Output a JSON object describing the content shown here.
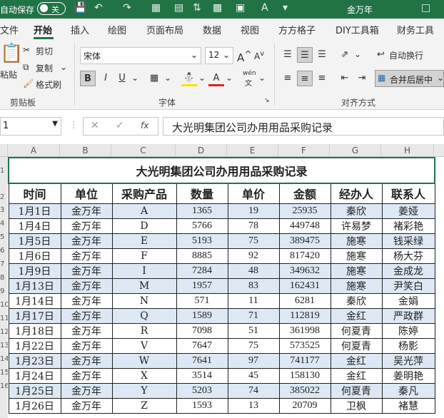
{
  "titlebar": {
    "autosave_label": "自动保存",
    "toggle_label": "关",
    "user_name": "金万年",
    "colors": {
      "bar": "#217346"
    }
  },
  "tabs": [
    "文件",
    "开始",
    "插入",
    "绘图",
    "页面布局",
    "数据",
    "视图",
    "方方格子",
    "DIY工具箱",
    "财务工具"
  ],
  "active_tab": "开始",
  "ribbon": {
    "clipboard": {
      "paste": "粘贴",
      "cut": "剪切",
      "copy": "复制",
      "format_painter": "格式刷",
      "label": "剪贴板"
    },
    "font": {
      "name": "宋体",
      "size": "12",
      "bold": "B",
      "italic": "I",
      "underline": "U",
      "grow": "A",
      "shrink": "A",
      "label": "字体",
      "wen": "wén"
    },
    "alignment": {
      "wrap": "自动换行",
      "merge": "合并后居中",
      "label": "对齐方式"
    }
  },
  "formula_bar": {
    "name_box": "1",
    "fx": "fx",
    "content": "大光明集团公司办用用品采购记录"
  },
  "columns": [
    "A",
    "B",
    "C",
    "D",
    "E",
    "F",
    "G",
    "H"
  ],
  "row_numbers": [
    "1",
    "2",
    "3",
    "4",
    "5",
    "6",
    "7",
    "8",
    "9",
    "10",
    "11",
    "12",
    "13",
    "14",
    "15",
    "16"
  ],
  "table": {
    "title": "大光明集团公司办用用品采购记录",
    "headers": [
      "时间",
      "单位",
      "采购产品",
      "数量",
      "单价",
      "金额",
      "经办人",
      "联系人"
    ],
    "rows": [
      [
        "1月1日",
        "金万年",
        "A",
        "1365",
        "19",
        "25935",
        "秦欣",
        "姜娅"
      ],
      [
        "1月4日",
        "金万年",
        "D",
        "5766",
        "78",
        "449748",
        "许易梦",
        "褚彩艳"
      ],
      [
        "1月5日",
        "金万年",
        "E",
        "5193",
        "75",
        "389475",
        "施寒",
        "钱采绿"
      ],
      [
        "1月6日",
        "金万年",
        "F",
        "8885",
        "92",
        "817420",
        "施寒",
        "杨大芬"
      ],
      [
        "1月9日",
        "金万年",
        "I",
        "7284",
        "48",
        "349632",
        "施寒",
        "金成龙"
      ],
      [
        "1月13日",
        "金万年",
        "M",
        "1957",
        "83",
        "162431",
        "施寒",
        "尹笑白"
      ],
      [
        "1月14日",
        "金万年",
        "N",
        "571",
        "11",
        "6281",
        "秦欣",
        "金娟"
      ],
      [
        "1月17日",
        "金万年",
        "Q",
        "1589",
        "71",
        "112819",
        "金红",
        "严政群"
      ],
      [
        "1月18日",
        "金万年",
        "R",
        "7098",
        "51",
        "361998",
        "何夏青",
        "陈婷"
      ],
      [
        "1月22日",
        "金万年",
        "V",
        "7647",
        "75",
        "573525",
        "何夏青",
        "杨影"
      ],
      [
        "1月23日",
        "金万年",
        "W",
        "7641",
        "97",
        "741177",
        "金红",
        "吴光萍"
      ],
      [
        "1月24日",
        "金万年",
        "X",
        "3514",
        "45",
        "158130",
        "金红",
        "姜明艳"
      ],
      [
        "1月25日",
        "金万年",
        "Y",
        "5203",
        "74",
        "385022",
        "何夏青",
        "秦凡"
      ],
      [
        "1月26日",
        "金万年",
        "Z",
        "1593",
        "13",
        "20709",
        "卫枫",
        "褚慧"
      ]
    ],
    "shaded_rows": [
      0,
      2,
      4,
      5,
      7,
      10,
      12
    ]
  }
}
